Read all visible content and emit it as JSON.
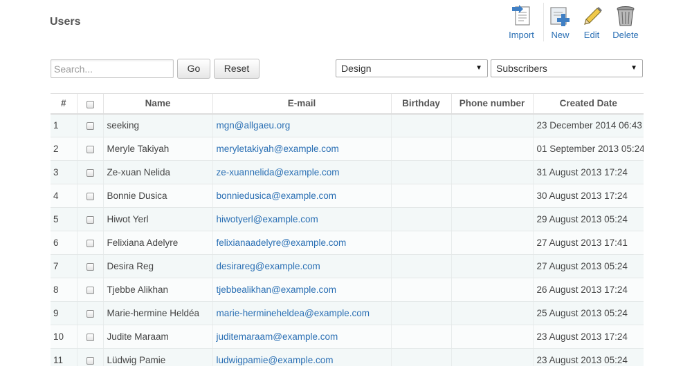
{
  "page": {
    "title": "Users"
  },
  "toolbar": {
    "import_label": "Import",
    "new_label": "New",
    "edit_label": "Edit",
    "delete_label": "Delete",
    "icons": [
      "import-icon",
      "new-user-icon",
      "edit-pencil-icon",
      "delete-trash-icon"
    ]
  },
  "search": {
    "placeholder": "Search...",
    "value": ""
  },
  "buttons": {
    "go": "Go",
    "reset": "Reset"
  },
  "filters": {
    "design": "Design",
    "subscribers": "Subscribers"
  },
  "table": {
    "headers": {
      "num": "#",
      "name": "Name",
      "email": "E-mail",
      "birthday": "Birthday",
      "phone": "Phone number",
      "created": "Created Date"
    },
    "rows": [
      {
        "num": "1",
        "name": "seeking",
        "email": "mgn@allgaeu.org",
        "birthday": "",
        "phone": "",
        "created": "23 December 2014 06:43"
      },
      {
        "num": "2",
        "name": "Meryle Takiyah",
        "email": "meryletakiyah@example.com",
        "birthday": "",
        "phone": "",
        "created": "01 September 2013 05:24"
      },
      {
        "num": "3",
        "name": "Ze-xuan Nelida",
        "email": "ze-xuannelida@example.com",
        "birthday": "",
        "phone": "",
        "created": "31 August 2013 17:24"
      },
      {
        "num": "4",
        "name": "Bonnie Dusica",
        "email": "bonniedusica@example.com",
        "birthday": "",
        "phone": "",
        "created": "30 August 2013 17:24"
      },
      {
        "num": "5",
        "name": "Hiwot Yerl",
        "email": "hiwotyerl@example.com",
        "birthday": "",
        "phone": "",
        "created": "29 August 2013 05:24"
      },
      {
        "num": "6",
        "name": "Felixiana Adelyre",
        "email": "felixianaadelyre@example.com",
        "birthday": "",
        "phone": "",
        "created": "27 August 2013 17:41"
      },
      {
        "num": "7",
        "name": "Desira Reg",
        "email": "desirareg@example.com",
        "birthday": "",
        "phone": "",
        "created": "27 August 2013 05:24"
      },
      {
        "num": "8",
        "name": "Tjebbe Alikhan",
        "email": "tjebbealikhan@example.com",
        "birthday": "",
        "phone": "",
        "created": "26 August 2013 17:24"
      },
      {
        "num": "9",
        "name": "Marie-hermine Heldéa",
        "email": "marie-hermineheldea@example.com",
        "birthday": "",
        "phone": "",
        "created": "25 August 2013 05:24"
      },
      {
        "num": "10",
        "name": "Judite Maraam",
        "email": "juditemaraam@example.com",
        "birthday": "",
        "phone": "",
        "created": "23 August 2013 17:24"
      },
      {
        "num": "11",
        "name": "Lüdwig Pamie",
        "email": "ludwigpamie@example.com",
        "birthday": "",
        "phone": "",
        "created": "23 August 2013 05:24"
      }
    ]
  },
  "colors": {
    "link": "#2a6fb4",
    "row_stripe": "#f3f8f8",
    "header_text": "#555555"
  }
}
